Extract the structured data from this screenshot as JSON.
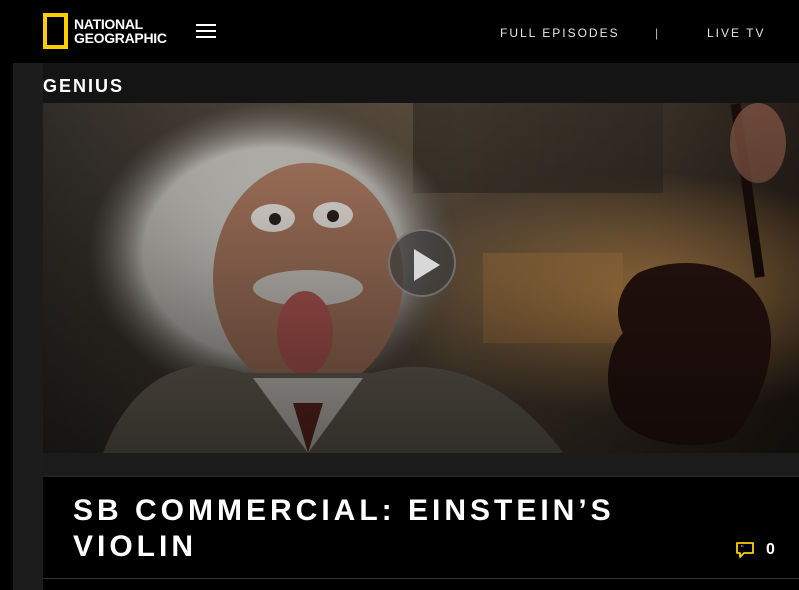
{
  "header": {
    "logo_text_line1": "NATIONAL",
    "logo_text_line2": "GEOGRAPHIC",
    "nav": {
      "full_episodes": "FULL EPISODES",
      "separator": "|",
      "live_tv": "LIVE TV"
    }
  },
  "show": {
    "title": "GENIUS"
  },
  "video": {
    "title": "SB COMMERCIAL: EINSTEIN’S VIOLIN",
    "comment_count": "0"
  },
  "colors": {
    "brand_yellow": "#ffce00",
    "background": "#000000"
  },
  "icons": {
    "menu": "hamburger-icon",
    "play": "play-icon",
    "comments": "comment-bubble-icon"
  }
}
